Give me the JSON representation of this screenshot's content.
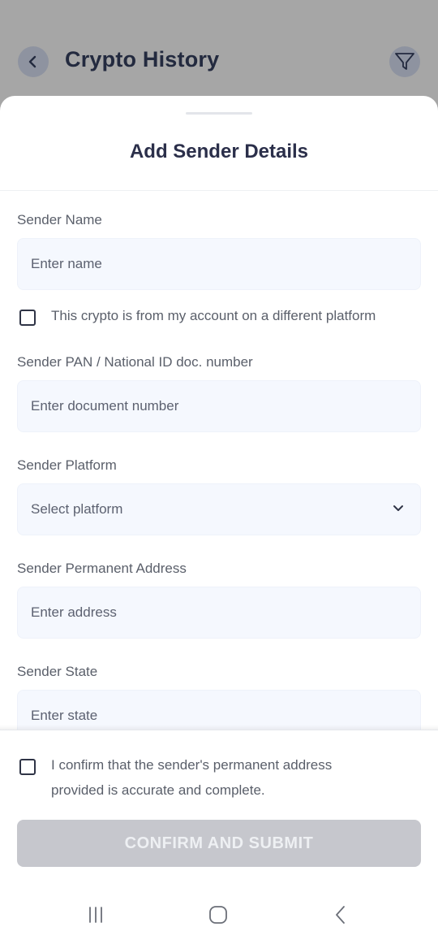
{
  "appbar": {
    "title": "Crypto History",
    "back_icon": "chevron-left-icon",
    "filter_icon": "filter-icon"
  },
  "sheet": {
    "title": "Add Sender Details",
    "fields": {
      "name": {
        "label": "Sender Name",
        "placeholder": "Enter name"
      },
      "different_platform_checkbox": "This crypto is from my account on a different platform",
      "pan": {
        "label": "Sender PAN / National ID doc. number",
        "placeholder": "Enter document number"
      },
      "platform": {
        "label": "Sender Platform",
        "placeholder": "Select platform"
      },
      "address": {
        "label": "Sender Permanent Address",
        "placeholder": "Enter address"
      },
      "state": {
        "label": "Sender State",
        "placeholder": "Enter state"
      }
    }
  },
  "footer": {
    "confirm_line1": "I confirm that the sender's permanent address",
    "confirm_line2": "provided is accurate and complete.",
    "submit_label": "CONFIRM AND SUBMIT"
  },
  "system_nav": {
    "recents_icon": "recents-icon",
    "home_icon": "home-icon",
    "back_icon": "back-icon"
  },
  "colors": {
    "title_text": "#2b2f4a",
    "field_bg": "#f5f8fe",
    "disabled_button": "#c6c7cd",
    "overlay": "#a6a6a6"
  }
}
